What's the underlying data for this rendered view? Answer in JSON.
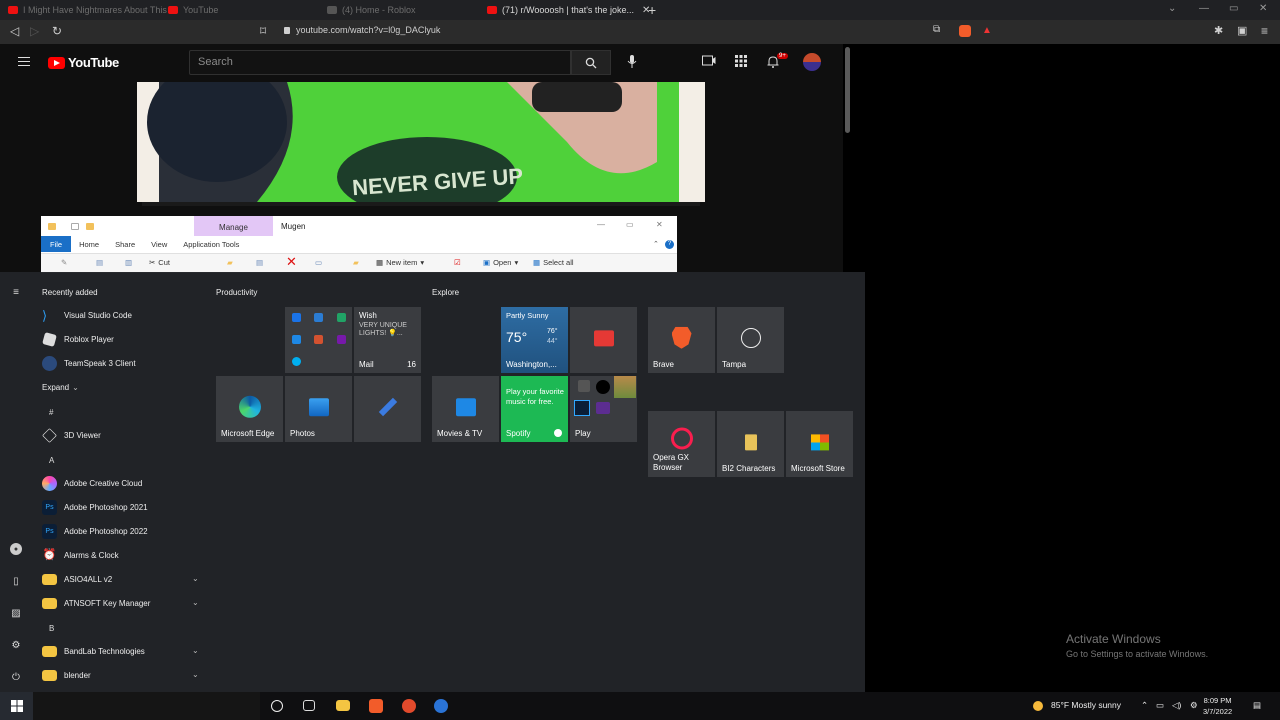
{
  "browser": {
    "tabs": [
      {
        "label": "I Might Have Nightmares About This",
        "state": "inactive"
      },
      {
        "label": "YouTube",
        "state": "inactive"
      },
      {
        "label": "(4) Home - Roblox",
        "state": "inactive"
      },
      {
        "label": "(71) r/Woooosh | that's the joke...",
        "state": "active"
      }
    ],
    "new_tab": "+",
    "url": "youtube.com/watch?v=l0g_DAClyuk"
  },
  "youtube": {
    "logo_text": "YouTube",
    "search_placeholder": "Search",
    "notification_count": "9+",
    "video_shirt_text": "NEVER GIVE UP"
  },
  "file_explorer": {
    "title": "Mugen",
    "manage_tab": "Manage",
    "tabs": [
      "File",
      "Home",
      "Share",
      "View",
      "Application Tools"
    ],
    "ribbon": {
      "cut": "Cut",
      "new_item": "New item",
      "open": "Open",
      "select_all": "Select all"
    }
  },
  "start_menu": {
    "recently_added_label": "Recently added",
    "recent_apps": [
      "Visual Studio Code",
      "Roblox Player",
      "TeamSpeak 3 Client"
    ],
    "expand_label": "Expand",
    "app_list": [
      {
        "type": "letter",
        "text": "#"
      },
      {
        "type": "app",
        "text": "3D Viewer"
      },
      {
        "type": "letter",
        "text": "A"
      },
      {
        "type": "app",
        "text": "Adobe Creative Cloud"
      },
      {
        "type": "app",
        "text": "Adobe Photoshop 2021"
      },
      {
        "type": "app",
        "text": "Adobe Photoshop 2022"
      },
      {
        "type": "app",
        "text": "Alarms & Clock"
      },
      {
        "type": "folder",
        "text": "ASIO4ALL v2"
      },
      {
        "type": "folder",
        "text": "ATNSOFT Key Manager"
      },
      {
        "type": "letter",
        "text": "B"
      },
      {
        "type": "folder",
        "text": "BandLab Technologies"
      },
      {
        "type": "folder",
        "text": "blender"
      }
    ],
    "groups": {
      "productivity": "Productivity",
      "explore": "Explore"
    },
    "tiles": {
      "mail": {
        "label": "Mail",
        "count": "16",
        "sender": "Wish",
        "preview": "VERY UNIQUE LIGHTS! 💡..."
      },
      "weather": {
        "condition": "Partly Sunny",
        "temp": "75°",
        "high": "76°",
        "low": "44°",
        "city": "Washington,..."
      },
      "edge": "Microsoft Edge",
      "photos": "Photos",
      "movies": "Movies & TV",
      "spotify": {
        "label": "Spotify",
        "promo": "Play your favorite music for free."
      },
      "play": "Play",
      "brave": "Brave",
      "tampa": "Tampa",
      "opera": "Opera GX Browser",
      "bi2": "BI2 Characters",
      "store": "Microsoft Store"
    }
  },
  "activation": {
    "title": "Activate Windows",
    "subtitle": "Go to Settings to activate Windows."
  },
  "taskbar": {
    "weather": "85°F  Mostly sunny",
    "time": "8:09 PM",
    "date": "3/7/2022"
  }
}
